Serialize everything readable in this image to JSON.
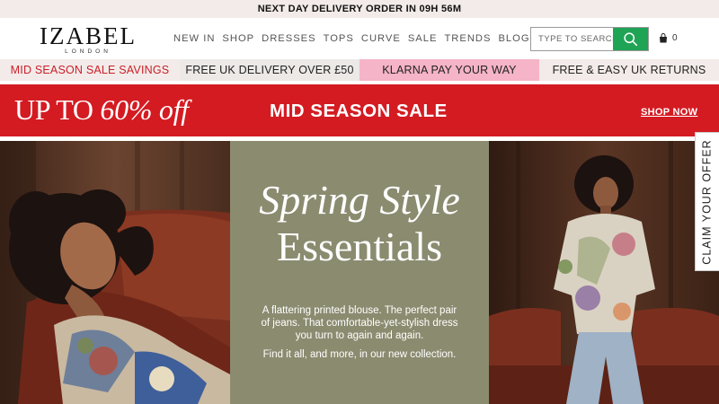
{
  "topbar": {
    "text": "NEXT DAY DELIVERY ORDER IN 09H 56M"
  },
  "brand": {
    "name": "IZABEL",
    "sub": "LONDON"
  },
  "nav": {
    "items": [
      "NEW IN",
      "SHOP",
      "DRESSES",
      "TOPS",
      "CURVE",
      "SALE",
      "TRENDS",
      "BLOG"
    ]
  },
  "search": {
    "placeholder": "TYPE TO SEARCH",
    "icon": "search-icon"
  },
  "cart": {
    "count": "0",
    "icon": "bag-icon"
  },
  "promos": {
    "p1": "MID SEASON SALE SAVINGS",
    "p2": "FREE UK DELIVERY OVER £50",
    "p3": "KLARNA PAY YOUR WAY",
    "p4": "FREE & EASY UK RETURNS"
  },
  "sale_banner": {
    "left_a": "UP TO ",
    "left_b": "60% off",
    "middle": "MID SEASON SALE",
    "cta": "SHOP NOW"
  },
  "hero": {
    "title_line1": "Spring Style",
    "title_line2": "Essentials",
    "copy1": "A flattering printed blouse. The perfect pair of jeans. That comfortable-yet-stylish dress you turn to again and again.",
    "copy2": "Find it all, and more, in our new collection."
  },
  "claim_tab": {
    "label": "CLAIM YOUR OFFER"
  },
  "colors": {
    "accent_green": "#1fa355",
    "sale_red": "#d41b22",
    "promo_pink": "#f5b4c7",
    "hero_panel": "#8b8b70"
  }
}
